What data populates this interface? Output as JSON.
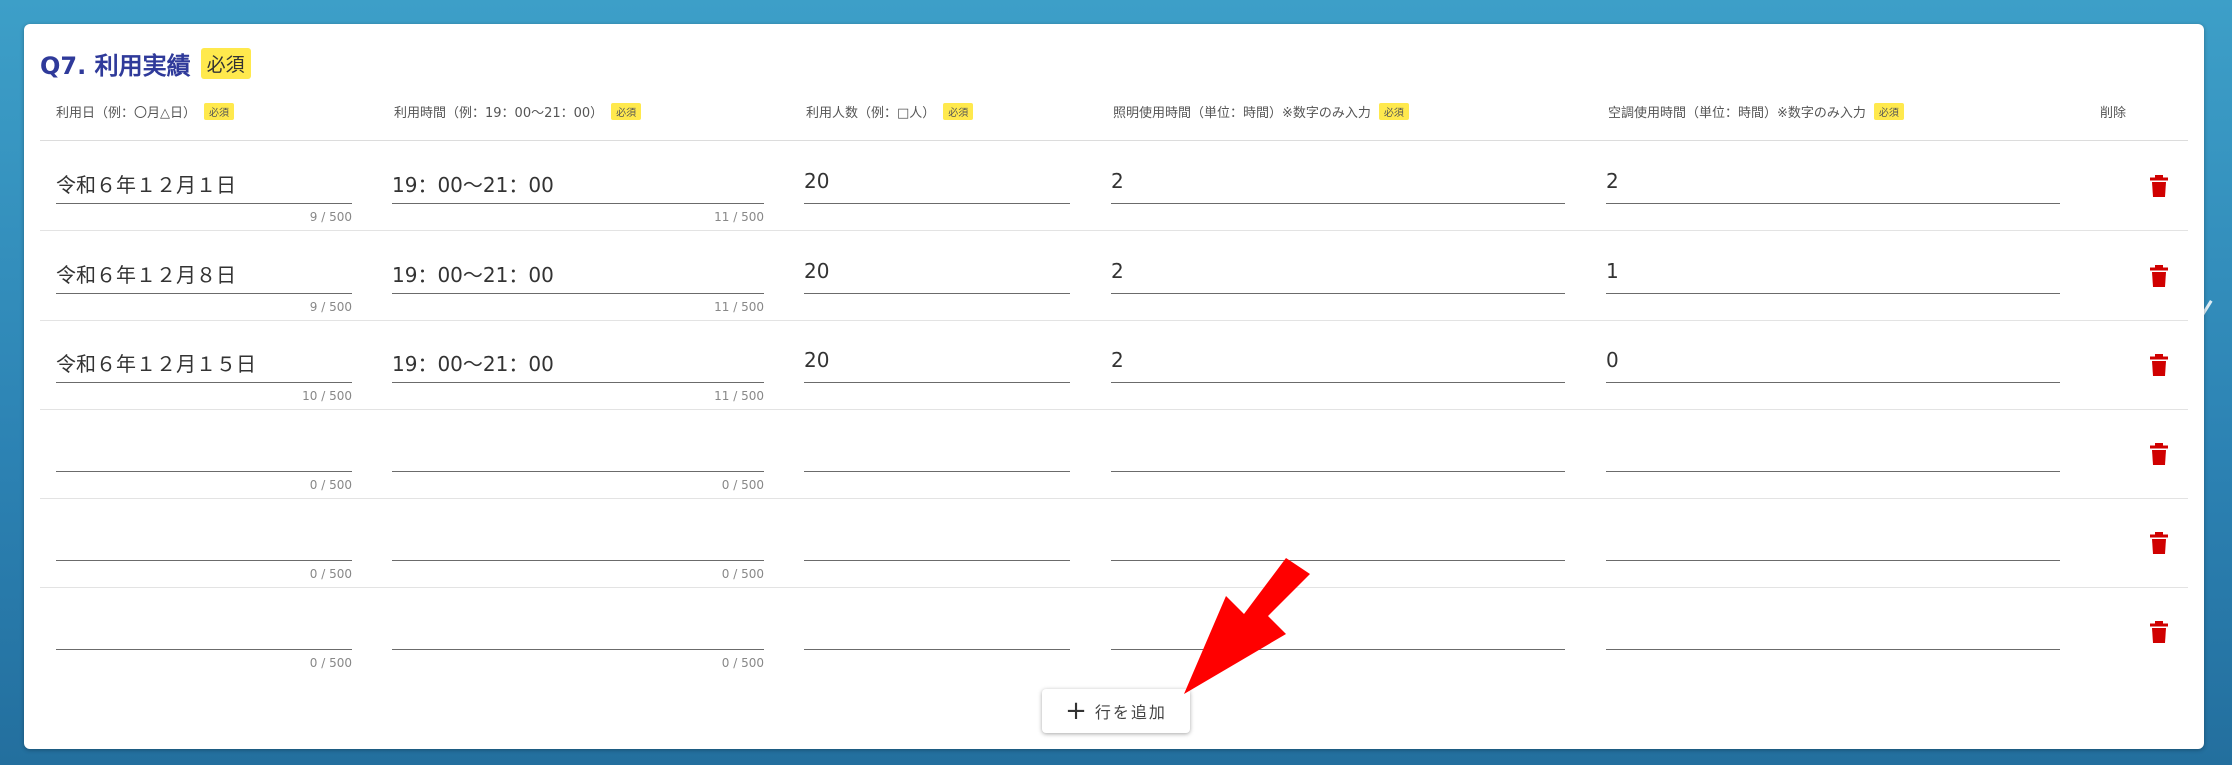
{
  "question": {
    "title": "Q7. 利用実績",
    "badge": "必須"
  },
  "columns": [
    {
      "label": "利用日（例：〇月△日）",
      "badge": "必須"
    },
    {
      "label": "利用時間（例：19：00〜21：00）",
      "badge": "必須"
    },
    {
      "label": "利用人数（例：□人）",
      "badge": "必須"
    },
    {
      "label": "照明使用時間（単位：時間）※数字のみ入力",
      "badge": "必須"
    },
    {
      "label": "空調使用時間（単位：時間）※数字のみ入力",
      "badge": "必須"
    },
    {
      "label": "削除",
      "badge": ""
    }
  ],
  "rows": [
    {
      "date": "令和６年１２月１日",
      "date_count": "9 / 500",
      "time": "19：00〜21：00",
      "time_count": "11 / 500",
      "people": "20",
      "lighting": "2",
      "aircon": "2"
    },
    {
      "date": "令和６年１２月８日",
      "date_count": "9 / 500",
      "time": "19：00〜21：00",
      "time_count": "11 / 500",
      "people": "20",
      "lighting": "2",
      "aircon": "1"
    },
    {
      "date": "令和６年１２月１５日",
      "date_count": "10 / 500",
      "time": "19：00〜21：00",
      "time_count": "11 / 500",
      "people": "20",
      "lighting": "2",
      "aircon": "0"
    },
    {
      "date": "",
      "date_count": "0 / 500",
      "time": "",
      "time_count": "0 / 500",
      "people": "",
      "lighting": "",
      "aircon": ""
    },
    {
      "date": "",
      "date_count": "0 / 500",
      "time": "",
      "time_count": "0 / 500",
      "people": "",
      "lighting": "",
      "aircon": ""
    },
    {
      "date": "",
      "date_count": "0 / 500",
      "time": "",
      "time_count": "0 / 500",
      "people": "",
      "lighting": "",
      "aircon": ""
    }
  ],
  "add_row": {
    "icon": "plus-icon",
    "label": "行を追加"
  },
  "icons": {
    "delete": "trash-icon",
    "annotation": "red-arrow-icon"
  },
  "colors": {
    "title": "#2f3a9a",
    "badge": "#ffe94d",
    "delete": "#d00000",
    "arrow": "#ff0000"
  }
}
